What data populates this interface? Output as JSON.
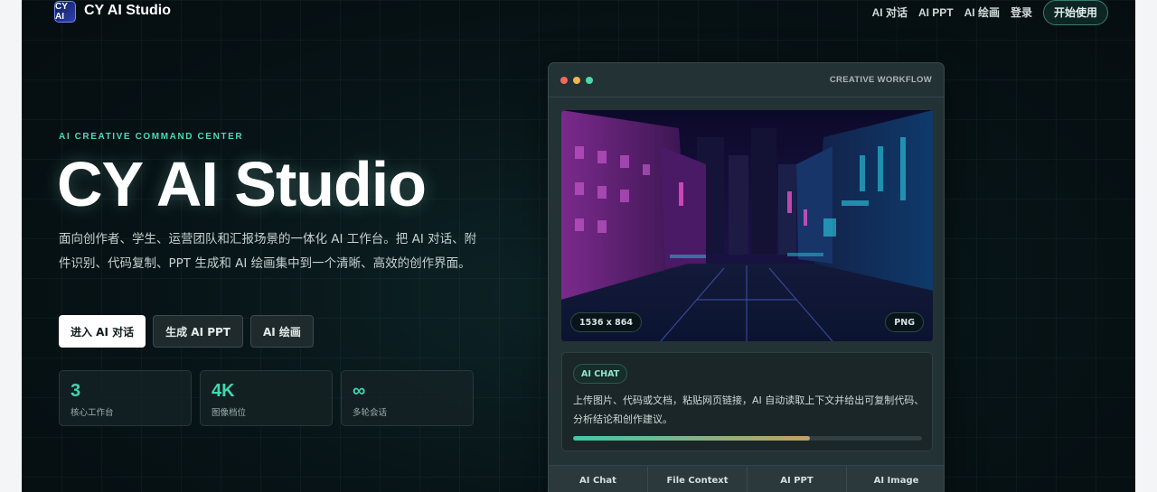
{
  "nav": {
    "logo_text": "CY AI",
    "brand": "CY AI Studio",
    "links": [
      "AI 对话",
      "AI PPT",
      "AI 绘画",
      "登录"
    ],
    "cta": "开始使用"
  },
  "hero": {
    "eyebrow": "AI CREATIVE COMMAND CENTER",
    "title": "CY AI Studio",
    "description": "面向创作者、学生、运营团队和汇报场景的一体化 AI 工作台。把 AI 对话、附件识别、代码复制、PPT 生成和 AI 绘画集中到一个清晰、高效的创作界面。",
    "buttons": [
      "进入 AI 对话",
      "生成 AI PPT",
      "AI 绘画"
    ],
    "stats": [
      {
        "value": "3",
        "label": "核心工作台"
      },
      {
        "value": "4K",
        "label": "图像档位"
      },
      {
        "value": "∞",
        "label": "多轮会话"
      }
    ]
  },
  "workflow": {
    "title": "CREATIVE WORKFLOW",
    "image_size": "1536 x 864",
    "image_format": "PNG",
    "chat_chip": "AI CHAT",
    "chat_text": "上传图片、代码或文档，粘贴网页链接，AI 自动读取上下文并给出可复制代码、分析结论和创作建议。",
    "progress": 0.68,
    "tabs": [
      "AI Chat",
      "File Context",
      "AI PPT",
      "AI Image"
    ]
  },
  "colors": {
    "accent": "#43d6b0",
    "dot_red": "#f26a5c",
    "dot_yellow": "#f0b84c",
    "dot_green": "#52d6a8"
  }
}
